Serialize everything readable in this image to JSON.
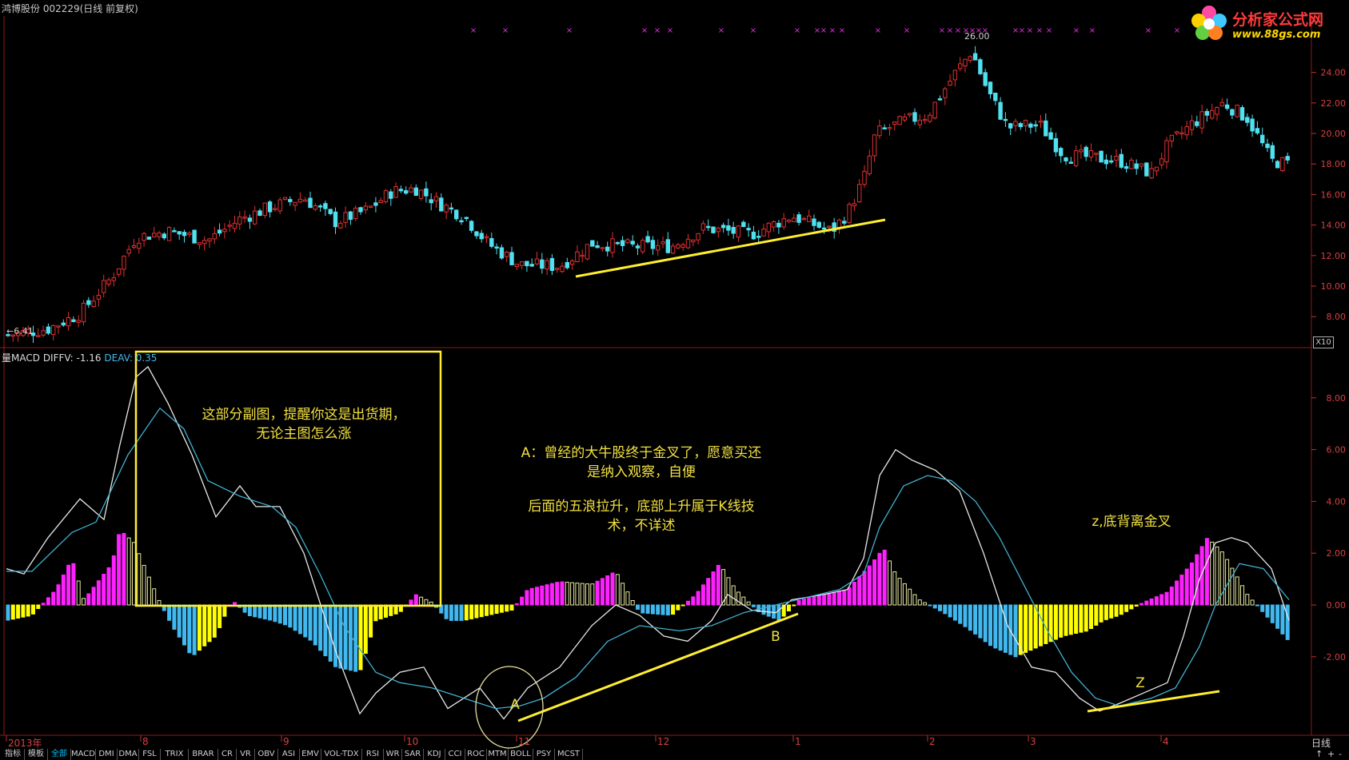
{
  "window": {
    "title": "鸿博股份 002229(日线 前复权)"
  },
  "logo": {
    "brand": "分析家公式网",
    "url": "www.88gs.com"
  },
  "colors": {
    "up": "#e03030",
    "down": "#50e0f0",
    "diff_line": "#e8e8e8",
    "dea_line": "#40b0d0",
    "hist_magenta": "#ff20ff",
    "hist_yellow": "#ffff00",
    "hist_blue": "#40b8f0",
    "hist_outline": "#e8e8a0",
    "annotation": "#f0e040",
    "axis": "#c03030"
  },
  "price_panel": {
    "low_label": "←6.41",
    "high_label": "26.00",
    "axis_ticks": [
      "24.00",
      "22.00",
      "20.00",
      "18.00",
      "16.00",
      "14.00",
      "12.00",
      "10.00",
      "8.00"
    ],
    "scale_badge": "X10"
  },
  "macd_panel": {
    "label_prefix": "量MACD",
    "diff_label": "DIFFV: -1.16",
    "dea_label": "DEAV: 0.35",
    "axis_ticks": [
      "8.00",
      "6.00",
      "4.00",
      "2.00",
      "0.00",
      "-2.00"
    ]
  },
  "annotations": {
    "box_note": "这部分副图，提醒你这是出货期，无论主图怎么涨",
    "note_a": "A：曾经的大牛股终于金叉了，愿意买还是纳入观察，自便",
    "note_wave": "后面的五浪拉升，底部上升属于K线技术，不详述",
    "note_z": "z,底背离金叉",
    "label_a": "A",
    "label_b": "B",
    "label_z": "Z"
  },
  "date_axis": {
    "labels": [
      "2013年",
      "8",
      "9",
      "10",
      "11",
      "12",
      "1",
      "2",
      "3",
      "4"
    ],
    "period": "日线"
  },
  "tabs": [
    "指标",
    "模板",
    "全部",
    "MACD",
    "DMI",
    "DMA",
    "FSL",
    "TRIX",
    "BRAR",
    "CR",
    "VR",
    "OBV",
    "ASI",
    "EMV",
    "VOL-TDX",
    "RSI",
    "WR",
    "SAR",
    "KDJ",
    "CCI",
    "ROC",
    "MTM",
    "BOLL",
    "PSY",
    "MCST"
  ],
  "active_tab": "全部",
  "controls": [
    "↑",
    "+",
    "-"
  ]
}
